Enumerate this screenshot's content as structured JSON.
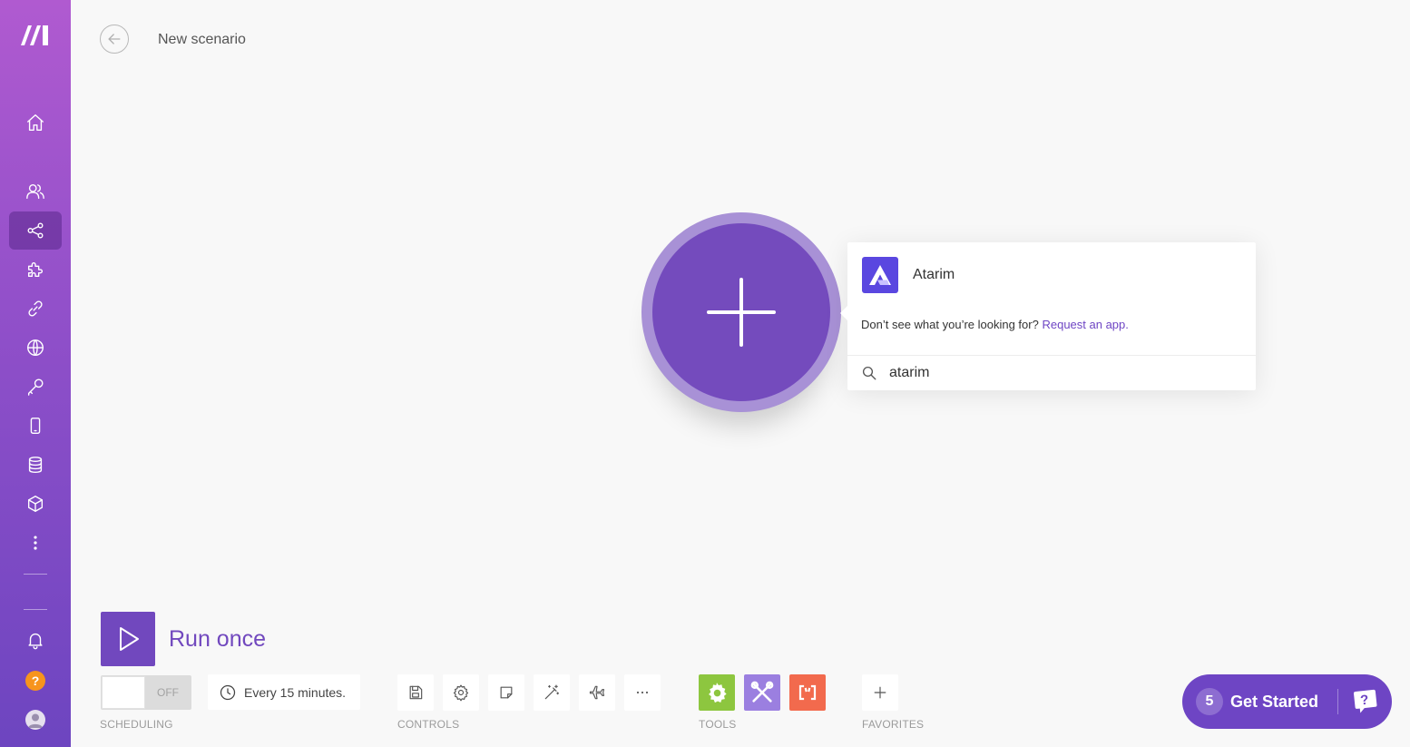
{
  "header": {
    "title": "New scenario"
  },
  "sidebar": {
    "logo": "make-logo",
    "items": [
      {
        "name": "home",
        "icon": "home-icon"
      },
      {
        "name": "team",
        "icon": "users-icon"
      },
      {
        "name": "scenarios",
        "icon": "share-icon",
        "active": true
      },
      {
        "name": "templates",
        "icon": "puzzle-icon"
      },
      {
        "name": "connections",
        "icon": "link-icon"
      },
      {
        "name": "webhooks",
        "icon": "globe-icon"
      },
      {
        "name": "keys",
        "icon": "key-icon"
      },
      {
        "name": "devices",
        "icon": "phone-icon"
      },
      {
        "name": "data-stores",
        "icon": "database-icon"
      },
      {
        "name": "data-structures",
        "icon": "cube-icon"
      },
      {
        "name": "more",
        "icon": "more-vertical-icon"
      },
      {
        "name": "notifications",
        "icon": "bell-icon"
      }
    ],
    "help_label": "?"
  },
  "search_popover": {
    "results": [
      {
        "name": "Atarim",
        "icon": "atarim-logo"
      }
    ],
    "missing_text": "Don’t see what you’re looking for?",
    "request_link": "Request an app.",
    "search_value": "atarim"
  },
  "controls": {
    "run_label": "Run once",
    "toggle_state": "OFF",
    "schedule_text": "Every 15 minutes.",
    "sections": {
      "scheduling": "SCHEDULING",
      "controls": "CONTROLS",
      "tools": "TOOLS",
      "favorites": "FAVORITES"
    },
    "control_icons": [
      "save-icon",
      "settings-icon",
      "note-icon",
      "magic-wand-icon",
      "airplane-icon",
      "more-horizontal-icon"
    ],
    "tools": [
      {
        "name": "flow-control",
        "color": "#8dc63f"
      },
      {
        "name": "tools",
        "color": "#9b7fe0"
      },
      {
        "name": "text-parser",
        "color": "#f26a4d"
      }
    ]
  },
  "get_started": {
    "count": "5",
    "label": "Get Started"
  },
  "colors": {
    "accent": "#6e45c4",
    "sidebar_top": "#b05ad0",
    "sidebar_bottom": "#6d45c0"
  }
}
